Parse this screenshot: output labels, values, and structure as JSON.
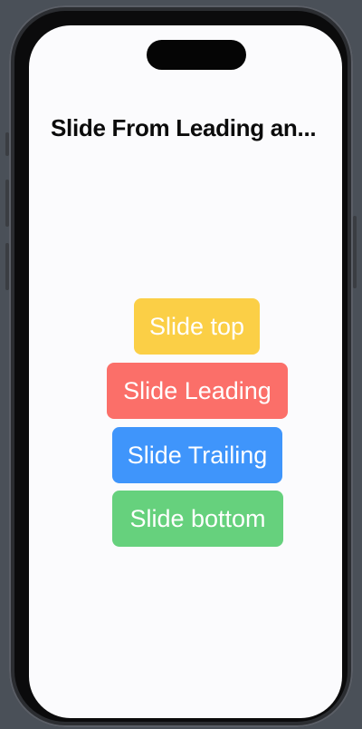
{
  "navigation": {
    "title": "Slide From Leading an..."
  },
  "buttons": {
    "top": "Slide top",
    "leading": "Slide Leading",
    "trailing": "Slide Trailing",
    "bottom": "Slide bottom"
  },
  "colors": {
    "top": "#fbcf46",
    "leading": "#fb6f69",
    "trailing": "#3f95fb",
    "bottom": "#66d17d"
  }
}
